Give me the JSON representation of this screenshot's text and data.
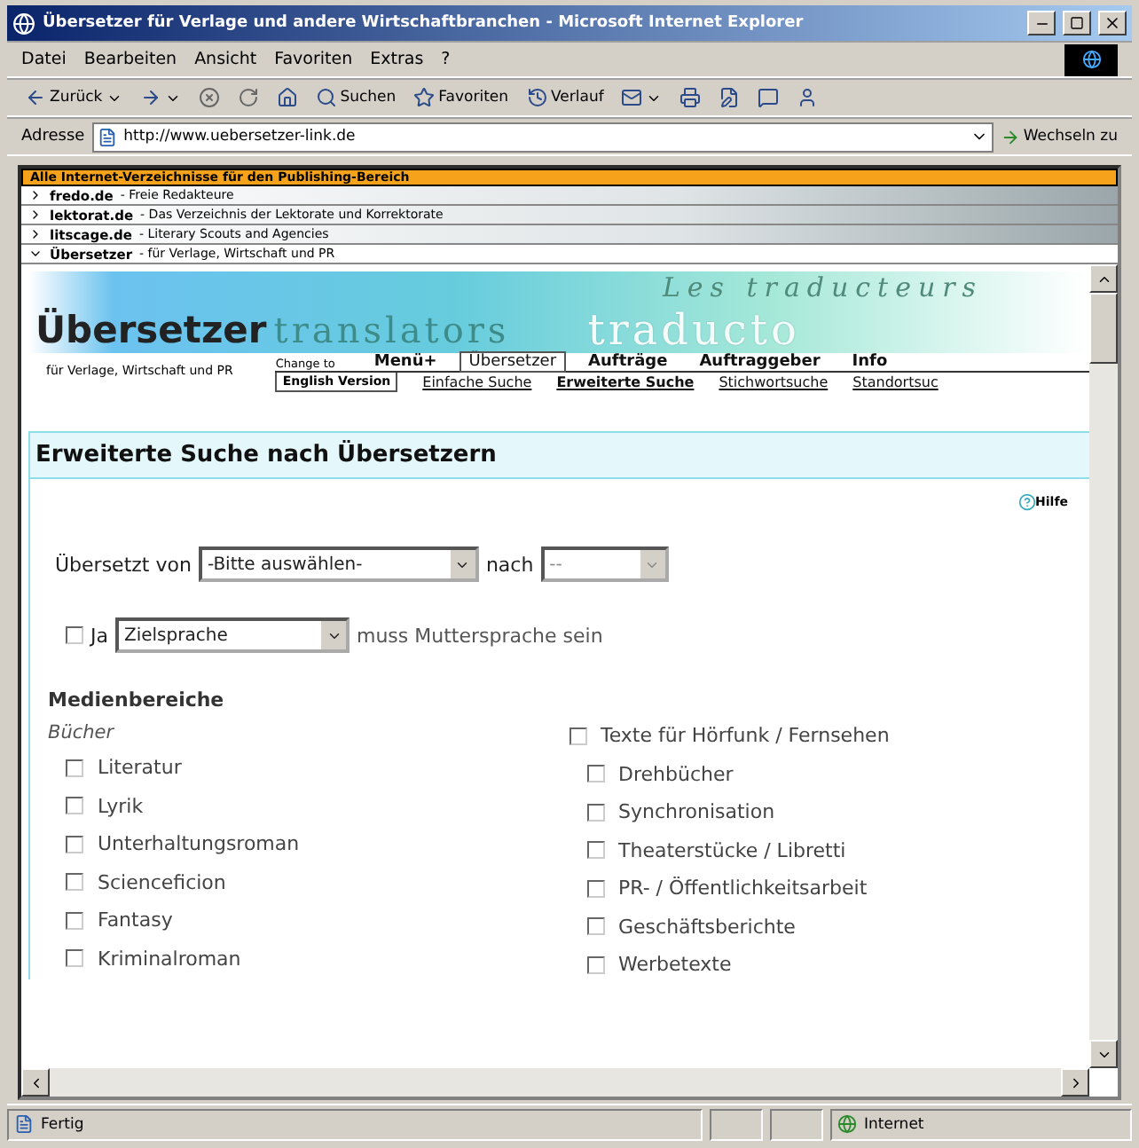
{
  "window": {
    "title": "Übersetzer für Verlage und andere Wirtschaftbranchen - Microsoft Internet Explorer"
  },
  "menu": [
    "Datei",
    "Bearbeiten",
    "Ansicht",
    "Favoriten",
    "Extras",
    "?"
  ],
  "toolbar": [
    {
      "kind": "back",
      "label": "Zurück"
    },
    {
      "kind": "forward"
    },
    {
      "kind": "stop"
    },
    {
      "kind": "refresh"
    },
    {
      "kind": "home"
    },
    {
      "kind": "search",
      "label": "Suchen"
    },
    {
      "kind": "favorites",
      "label": "Favoriten"
    },
    {
      "kind": "history",
      "label": "Verlauf"
    },
    {
      "kind": "mail"
    },
    {
      "kind": "print"
    },
    {
      "kind": "edit"
    },
    {
      "kind": "discuss"
    },
    {
      "kind": "messenger"
    }
  ],
  "address": {
    "label": "Adresse",
    "value": "http://www.uebersetzer-link.de",
    "go": "Wechseln zu"
  },
  "portal": {
    "header": "Alle Internet-Verzeichnisse für den Publishing-Bereich",
    "items": [
      {
        "name": "fredo.de",
        "description": "- Freie Redakteure",
        "expanded": false
      },
      {
        "name": "lektorat.de",
        "description": "- Das Verzeichnis der Lektorate und Korrektorate",
        "expanded": false
      },
      {
        "name": "litscage.de",
        "description": "- Literary Scouts and Agencies",
        "expanded": false
      },
      {
        "name": "Übersetzer",
        "description": "- für Verlage, Wirtschaft und PR",
        "expanded": true
      }
    ]
  },
  "site": {
    "logo": "Übersetzer",
    "logo_words": [
      "translators",
      "Les traducteurs",
      "traducto"
    ],
    "tagline": "für Verlage, Wirtschaft und PR",
    "change_to": "Change to",
    "english": "English Version",
    "tabs": [
      {
        "label": "Menü+",
        "selected": false
      },
      {
        "label": "Übersetzer",
        "selected": true
      },
      {
        "label": "Aufträge",
        "selected": false
      },
      {
        "label": "Auftraggeber",
        "selected": false
      },
      {
        "label": "Info",
        "selected": false
      }
    ],
    "subtabs": [
      {
        "label": "Einfache Suche",
        "selected": false
      },
      {
        "label": "Erweiterte Suche",
        "selected": true
      },
      {
        "label": "Stichwortsuche",
        "selected": false
      },
      {
        "label": "Standortsuc",
        "selected": false
      }
    ]
  },
  "search": {
    "title": "Erweiterte Suche nach Übersetzern",
    "help": "Hilfe",
    "from_label": "Übersetzt von",
    "from_value": "-Bitte auswählen-",
    "to_label": "nach",
    "to_value": "--",
    "native": {
      "checked": false,
      "label": "Ja",
      "value": "Zielsprache",
      "suffix": "muss Muttersprache sein"
    },
    "section": "Medienbereiche",
    "columns": [
      {
        "kind": "heading",
        "heading": {
          "label": "Bücher"
        },
        "items": [
          {
            "label": "Literatur",
            "checked": false
          },
          {
            "label": "Lyrik",
            "checked": false
          },
          {
            "label": "Unterhaltungsroman",
            "checked": false
          },
          {
            "label": "Scienceficion",
            "checked": false
          },
          {
            "label": "Fantasy",
            "checked": false
          },
          {
            "label": "Kriminalroman",
            "checked": false
          }
        ]
      },
      {
        "kind": "option",
        "heading": {
          "label": "Texte für Hörfunk / Fernsehen",
          "checked": false
        },
        "items": [
          {
            "label": "Drehbücher",
            "checked": false
          },
          {
            "label": "Synchronisation",
            "checked": false
          },
          {
            "label": "Theaterstücke / Libretti",
            "checked": false
          },
          {
            "label": "PR- / Öffentlichkeitsarbeit",
            "checked": false
          },
          {
            "label": "Geschäftsberichte",
            "checked": false
          },
          {
            "label": "Werbetexte",
            "checked": false
          }
        ]
      }
    ]
  },
  "status": {
    "text": "Fertig",
    "zone": "Internet"
  }
}
